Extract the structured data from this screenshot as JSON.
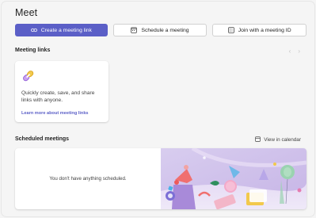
{
  "page": {
    "title": "Meet"
  },
  "actions": {
    "create_link": {
      "label": "Create a meeting link",
      "icon": "link-icon"
    },
    "schedule": {
      "label": "Schedule a meeting",
      "icon": "calendar-icon"
    },
    "join_id": {
      "label": "Join with a meeting ID",
      "icon": "keypad-icon"
    }
  },
  "meeting_links": {
    "heading": "Meeting links",
    "card": {
      "description": "Quickly create, save, and share links with anyone.",
      "learn_more": "Learn more about meeting links"
    }
  },
  "scheduled": {
    "heading": "Scheduled meetings",
    "view_calendar": "View in calendar",
    "empty_text": "You don't have anything scheduled."
  },
  "colors": {
    "accent": "#5b5fc7",
    "background": "#f5f5f5",
    "card": "#ffffff"
  }
}
